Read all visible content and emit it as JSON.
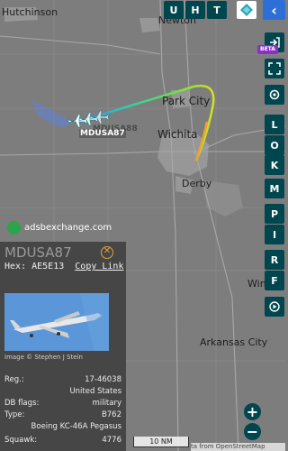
{
  "map": {
    "cities": [
      "Hutchinson",
      "Newton",
      "Park City",
      "Wichita",
      "Derby",
      "Winfield",
      "Arkansas City"
    ],
    "aircraft_label": "MDUSA87",
    "ghost_label": "MDUSA88",
    "watermark": "adsbexchange.com",
    "scale_label": "10 NM",
    "attribution": "ta from OpenStreetMap"
  },
  "top_bar": {
    "buttons": [
      "U",
      "H",
      "T"
    ]
  },
  "side_bar": {
    "beta_badge": "BETA",
    "letter_buttons": [
      "L",
      "O",
      "K",
      "M",
      "P",
      "I",
      "R",
      "F"
    ]
  },
  "zoom": {
    "in": "+",
    "out": "−"
  },
  "info_panel": {
    "callsign": "MDUSA87",
    "close_glyph": "⊗",
    "hex_label": "Hex:",
    "hex_value": "AE5E13",
    "copy_link": "Copy Link",
    "photo_credit": "Image © Stephen J Stein",
    "rows": [
      {
        "key": "Reg.:",
        "value": "17-46038"
      },
      {
        "key": "",
        "value": "United States"
      },
      {
        "key": "DB flags:",
        "value": "military"
      },
      {
        "key": "Type:",
        "value": "B762"
      },
      {
        "key": "",
        "value": "Boeing KC-46A Pegasus"
      },
      {
        "key": "Squawk:",
        "value": "4776"
      }
    ]
  },
  "colors": {
    "button_bg": "#00464f",
    "panel_bg": "#464646",
    "accent_orange": "#e6a13a",
    "collapse_blue": "#2d6fd6",
    "beta_purple": "#8b2fc9"
  }
}
